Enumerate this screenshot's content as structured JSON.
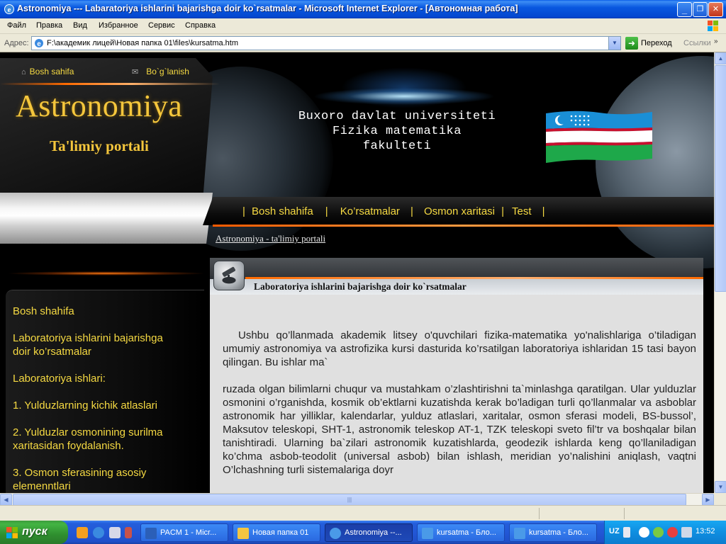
{
  "window": {
    "title": "Astronomiya --- Labaratoriya ishlarini bajarishga doir ko`rsatmalar - Microsoft Internet Explorer - [Автономная работа]",
    "minimize_label": "_",
    "maximize_label": "❐",
    "close_label": "✕"
  },
  "menu": {
    "items": [
      "Файл",
      "Правка",
      "Вид",
      "Избранное",
      "Сервис",
      "Справка"
    ]
  },
  "address": {
    "label": "Адрес:",
    "url": "F:\\академик  лицей\\Новая папка 01\\files\\kursatma.htm",
    "go_label": "Переход",
    "links_label": "Ссылки"
  },
  "page": {
    "top_links": [
      "Bosh sahifa",
      "Bo`g`lanish"
    ],
    "site_title": "Astronomiya",
    "site_subtitle": "Ta'limiy portali",
    "university_lines": [
      "Buxoro davlat universiteti",
      "Fizika matematika",
      "fakulteti"
    ],
    "nav_items": [
      "Bosh shahifa",
      "Ko’rsatmalar",
      "Osmon xaritasi",
      "Test"
    ],
    "breadcrumb": "Astronomiya - ta'limiy portali",
    "sidebar_items": [
      "Bosh shahifa",
      "Laboratoriya ishlarini bajarishga doir ko’rsatmalar",
      "Laboratoriya ishlari:",
      "1. Yulduzlarning kichik atlaslari",
      "2. Yulduzlar osmonining surilma xaritasidan foydalanish.",
      "3. Osmon sferasining asosiy elemenntlari"
    ],
    "content_title": "Laboratoriya ishlarini bajarishga doir ko`rsatmalar",
    "paragraph_1": "Ushbu qo’llanmada akademik litsey o'quvchilari fizika-matematika yo'nalishlariga o’tiladigan umumiy astronomiya va astrofizika kursi dasturida ko’rsatilgan laboratoriya ishlaridan 15 tasi bayon qilingan. Bu ishlar ma`",
    "paragraph_2": "ruzada olgan bilimlarni chuqur va mustahkam o’zlashtirishni ta`minlashga qaratilgan. Ular yulduzlar osmonini o’rganishda, kosmik ob’ektlarni kuzatishda kerak bo’ladigan turli qo’llanmalar va asboblar astronomik har yilliklar, kalendarlar, yulduz atlaslari, xaritalar, osmon sferasi modeli, BS-bussol’, Maksutov teleskopi, SHT-1, astronomik teleskop AT-1, TZK teleskopi sveto fil’tr va boshqalar bilan tanishtiradi. Ularning ba`zilari astronomik kuzatishlarda, geodezik ishlarda keng qo’llaniladigan ko’chma asbob-teodolit (universal asbob) bilan ishlash, meridian yo’nalishini aniqlash, vaqtni O’lchashning turli sistemalariga doyr"
  },
  "taskbar": {
    "start_label": "пуск",
    "tasks": [
      {
        "label": "PACM 1 - Micr...",
        "icon_color": "#2b5fb8"
      },
      {
        "label": "Новая папка 01",
        "icon_color": "#f4c542"
      },
      {
        "label": "Astronomiya --...",
        "icon_color": "#4a9ae8"
      },
      {
        "label": "kursatma - Бло...",
        "icon_color": "#4a9ae8"
      },
      {
        "label": "kursatma - Бло...",
        "icon_color": "#4a9ae8"
      }
    ],
    "active_task": 2,
    "language": "UZ",
    "clock": "13:52"
  }
}
